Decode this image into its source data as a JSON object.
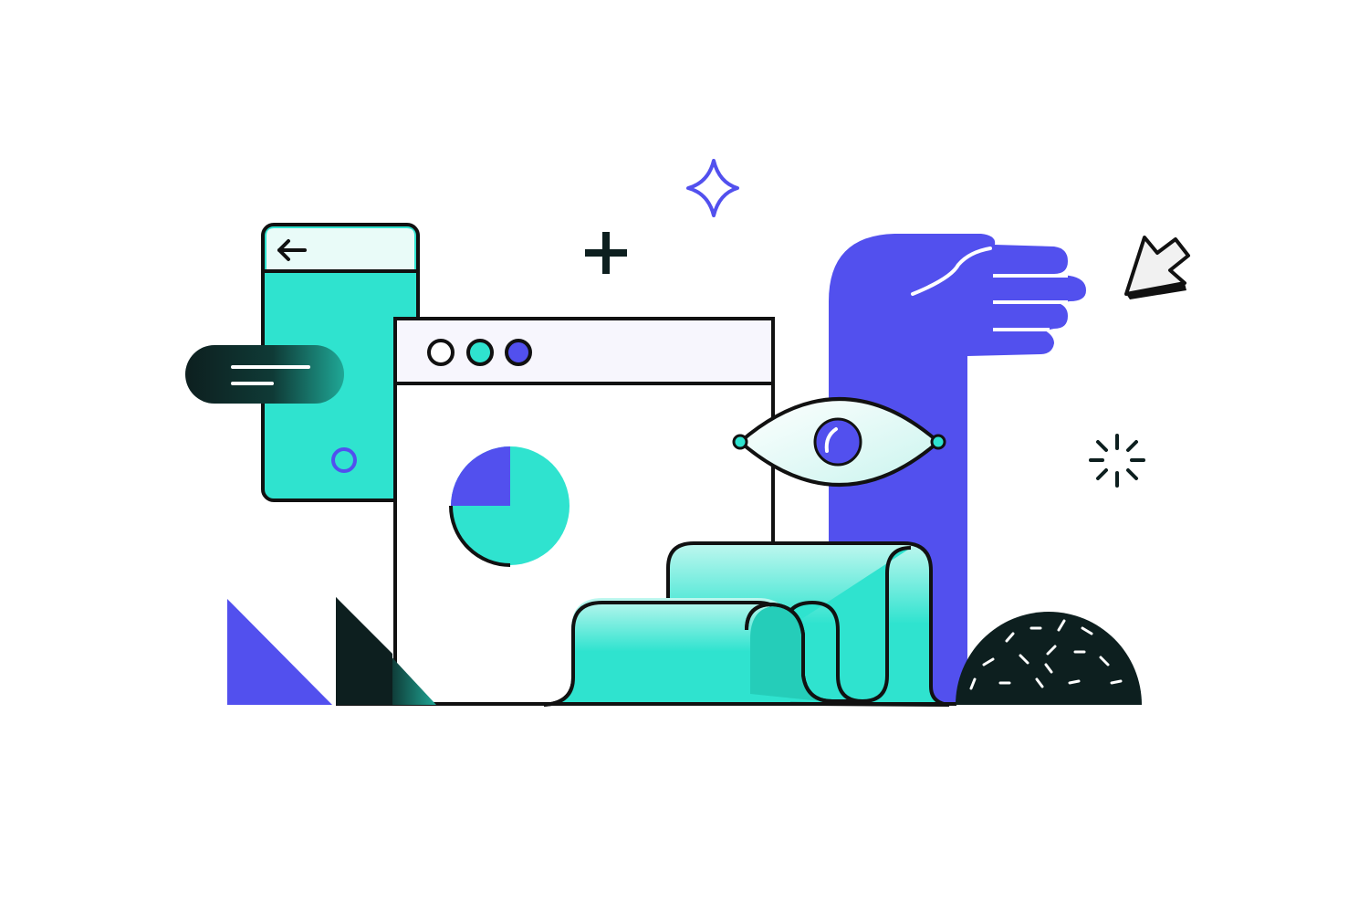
{
  "palette": {
    "background": "#ffffff",
    "teal": "#2fe3cf",
    "purple": "#5250ee",
    "outline": "#111111",
    "dark": "#0d1f1f"
  },
  "illustration": {
    "phone": {
      "icon": "arrow-left-icon"
    },
    "browser": {
      "window_dots": [
        "white",
        "teal",
        "purple"
      ],
      "pie_chart": {
        "purple_share": 0.25,
        "teal_share": 0.75
      }
    },
    "eye": {
      "icon": "eye-icon"
    },
    "hand": {
      "icon": "hand-icon"
    },
    "cursor": {
      "icon": "cursor-arrow-icon"
    },
    "decorations": [
      "sparkle-icon",
      "plus-icon",
      "burst-icon",
      "triangle-shapes",
      "sprinkle-dome"
    ]
  }
}
